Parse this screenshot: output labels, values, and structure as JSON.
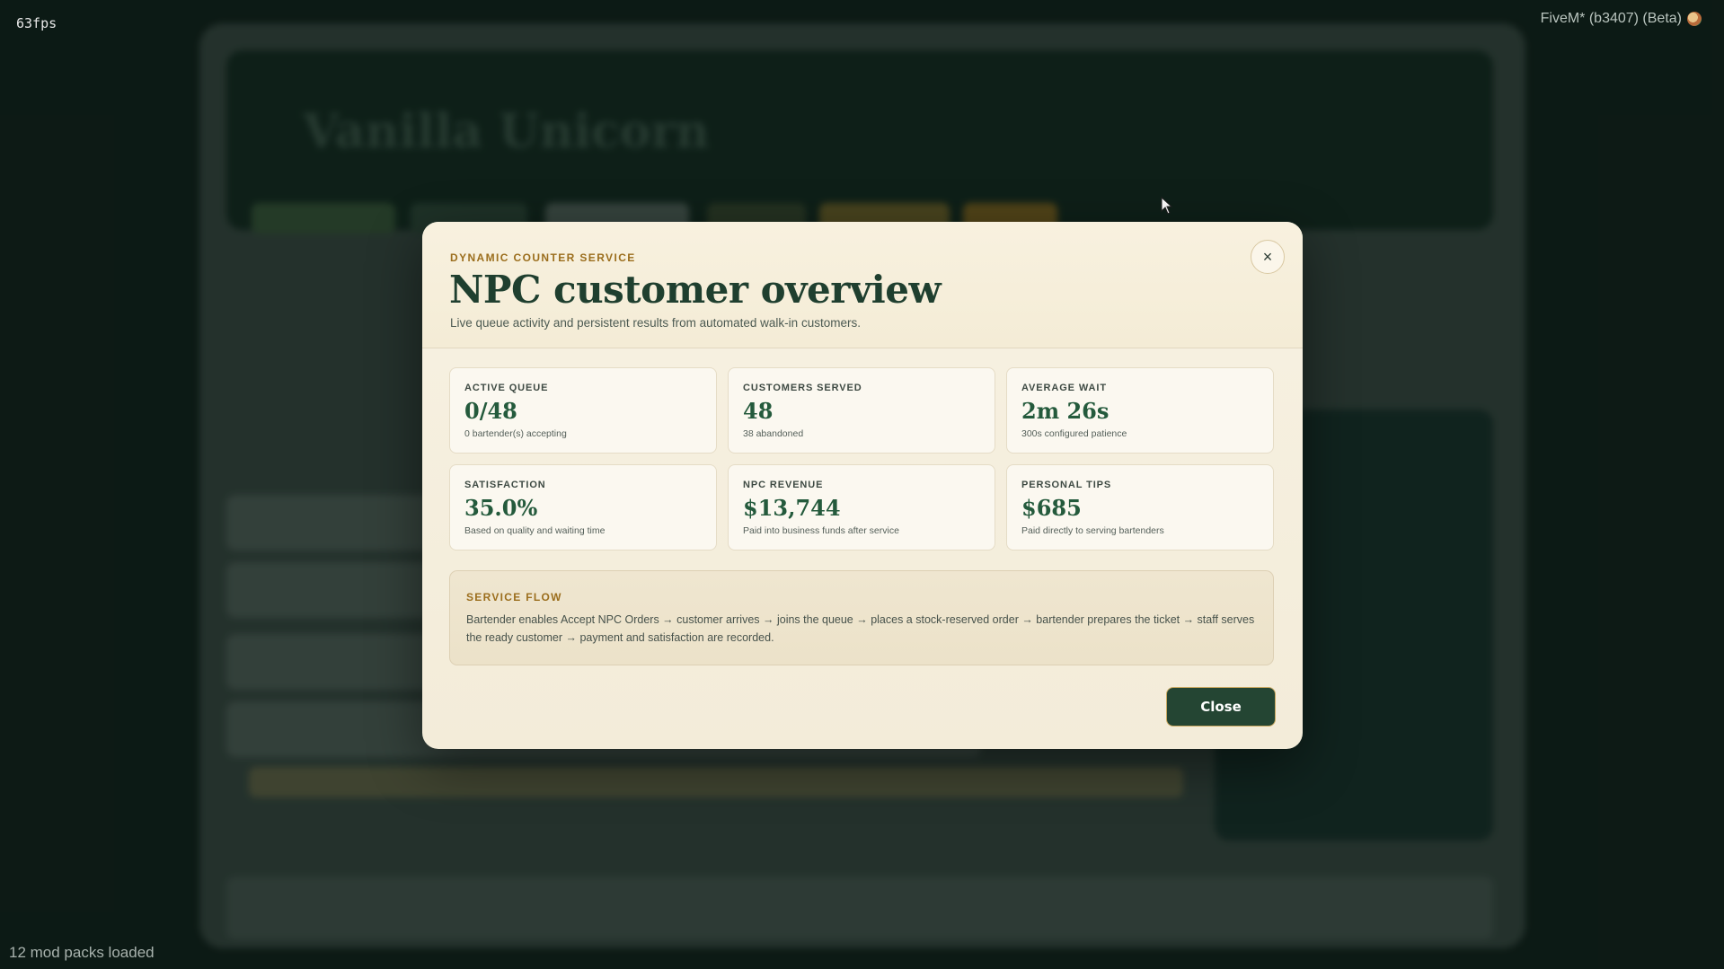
{
  "hud": {
    "fps": "63fps",
    "brand": "FiveM* (b3407) (Beta)",
    "mods": "12 mod packs loaded"
  },
  "background": {
    "title": "Vanilla Unicorn"
  },
  "modal": {
    "eyebrow": "DYNAMIC COUNTER SERVICE",
    "title": "NPC customer overview",
    "subtitle": "Live queue activity and persistent results from automated walk-in customers.",
    "close_icon": "×",
    "stats": [
      {
        "label": "ACTIVE QUEUE",
        "value": "0/48",
        "note": "0 bartender(s) accepting"
      },
      {
        "label": "CUSTOMERS SERVED",
        "value": "48",
        "note": "38 abandoned"
      },
      {
        "label": "AVERAGE WAIT",
        "value": "2m 26s",
        "note": "300s configured patience"
      },
      {
        "label": "SATISFACTION",
        "value": "35.0%",
        "note": "Based on quality and waiting time"
      },
      {
        "label": "NPC REVENUE",
        "value": "$13,744",
        "note": "Paid into business funds after service"
      },
      {
        "label": "PERSONAL TIPS",
        "value": "$685",
        "note": "Paid directly to serving bartenders"
      }
    ],
    "flow": {
      "label": "SERVICE FLOW",
      "text": "Bartender enables Accept NPC Orders → customer arrives → joins the queue → places a stock-reserved order → bartender prepares the ticket → staff serves the ready customer → payment and satisfaction are recorded."
    },
    "close_label": "Close"
  }
}
